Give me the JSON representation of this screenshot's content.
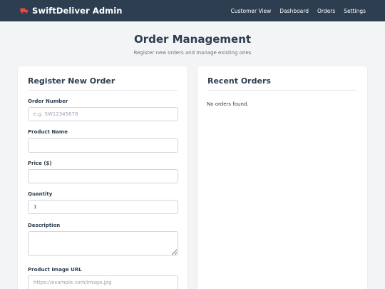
{
  "app": {
    "brand": "SwiftDeliver Admin",
    "brand_icon": "truck-icon",
    "brand_icon_color": "#e74c3c"
  },
  "nav": {
    "links": [
      {
        "label": "Customer View"
      },
      {
        "label": "Dashboard"
      },
      {
        "label": "Orders"
      },
      {
        "label": "Settings"
      }
    ]
  },
  "header": {
    "title": "Order Management",
    "subtitle": "Register new orders and manage existing ones"
  },
  "register_form": {
    "title": "Register New Order",
    "order_number": {
      "label": "Order Number",
      "placeholder": "e.g. SW12345678",
      "value": ""
    },
    "product_name": {
      "label": "Product Name",
      "value": ""
    },
    "price": {
      "label": "Price ($)",
      "value": ""
    },
    "quantity": {
      "label": "Quantity",
      "value": "1"
    },
    "description": {
      "label": "Description",
      "value": ""
    },
    "image_url": {
      "label": "Product Image URL",
      "placeholder": "https://example.com/image.jpg",
      "value": ""
    }
  },
  "recent_orders": {
    "title": "Recent Orders",
    "empty_message": "No orders found."
  },
  "colors": {
    "navbar": "#2c3e50",
    "background": "#f3f4f6",
    "accent": "#e74c3c"
  }
}
